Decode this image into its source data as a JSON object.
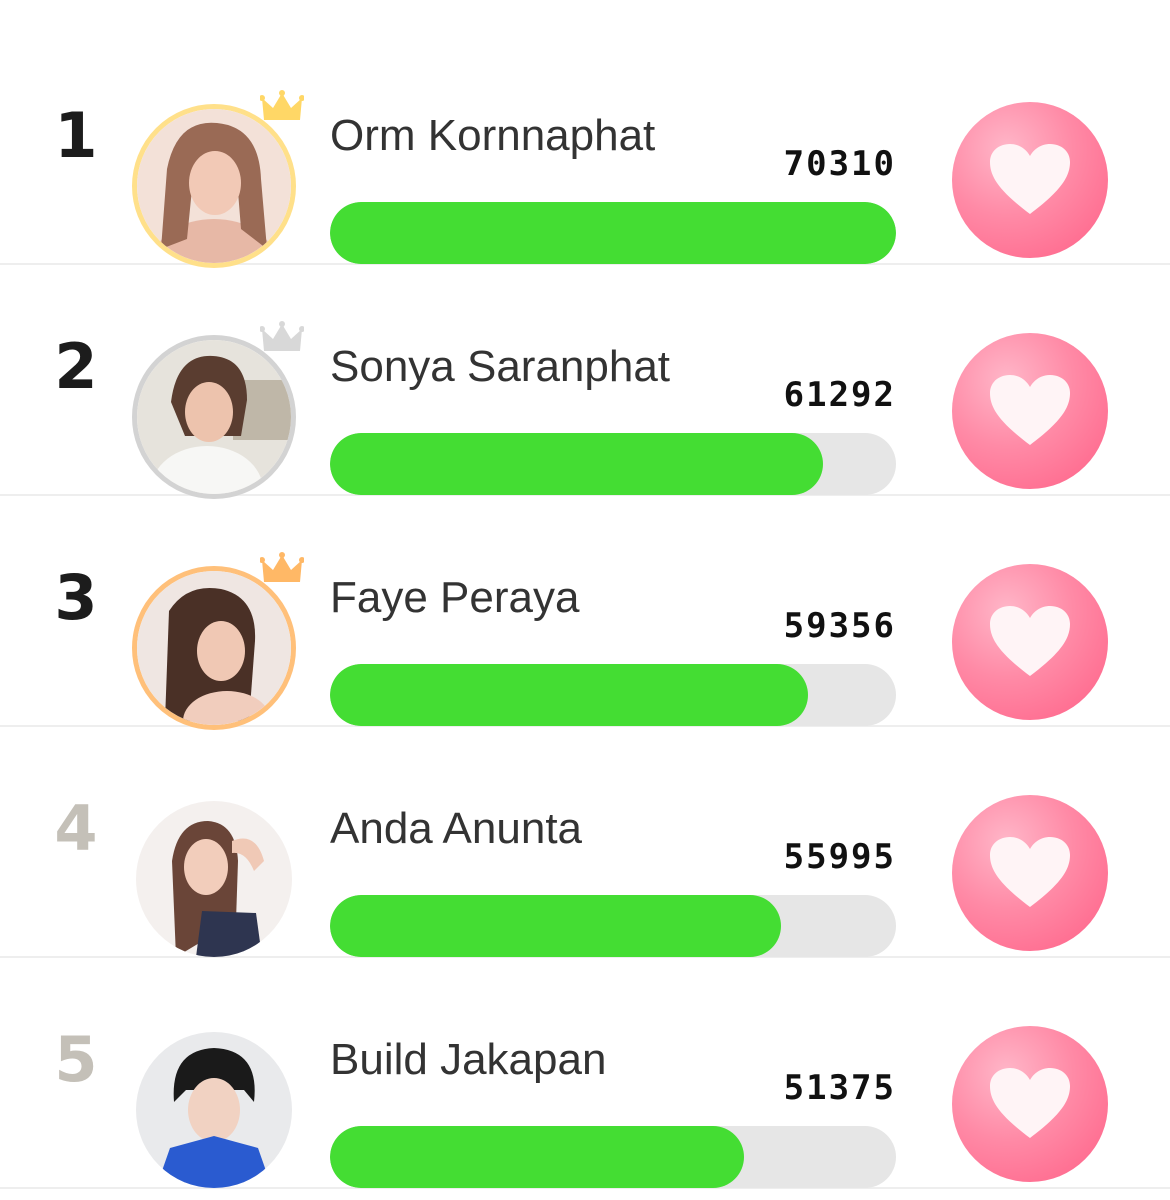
{
  "leaderboard": {
    "max_score": 70310,
    "entries": [
      {
        "rank": "1",
        "name": "Orm Kornnaphat",
        "score": "70310",
        "score_value": 70310,
        "tier": "gold",
        "avatar": "avatar-orm-kornnaphat"
      },
      {
        "rank": "2",
        "name": "Sonya Saranphat",
        "score": "61292",
        "score_value": 61292,
        "tier": "silver",
        "avatar": "avatar-sonya-saranphat"
      },
      {
        "rank": "3",
        "name": "Faye Peraya",
        "score": "59356",
        "score_value": 59356,
        "tier": "bronze",
        "avatar": "avatar-faye-peraya"
      },
      {
        "rank": "4",
        "name": "Anda Anunta",
        "score": "55995",
        "score_value": 55995,
        "tier": "none",
        "avatar": "avatar-anda-anunta"
      },
      {
        "rank": "5",
        "name": "Build Jakapan",
        "score": "51375",
        "score_value": 51375,
        "tier": "none",
        "avatar": "avatar-build-jakapan"
      }
    ]
  },
  "colors": {
    "bar_fill": "#44dd33",
    "bar_track": "#e6e6e6",
    "like_button": "#ff7a9a",
    "gold_ring": "#ffe08a",
    "silver_ring": "#d3d3d3",
    "bronze_ring": "#ffc07a",
    "crown_gold": "#ffd766",
    "crown_silver": "#d8d8d8",
    "crown_bronze": "#ffb866"
  },
  "icons": {
    "like": "heart-icon",
    "crown": "crown-icon"
  }
}
